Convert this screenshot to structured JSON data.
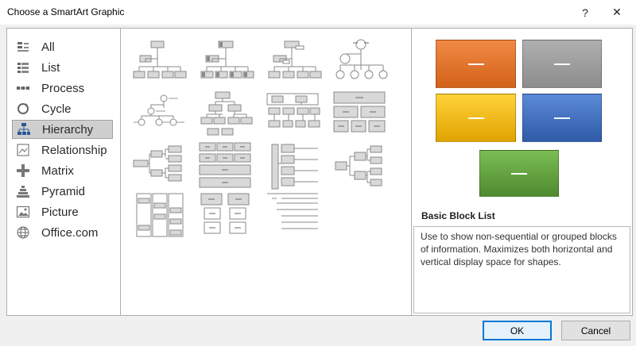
{
  "window": {
    "title": "Choose a SmartArt Graphic",
    "help_label": "?",
    "close_label": "✕"
  },
  "categories": [
    {
      "label": "All",
      "icon": "all-icon"
    },
    {
      "label": "List",
      "icon": "list-icon"
    },
    {
      "label": "Process",
      "icon": "process-icon"
    },
    {
      "label": "Cycle",
      "icon": "cycle-icon"
    },
    {
      "label": "Hierarchy",
      "icon": "hierarchy-icon",
      "selected": true
    },
    {
      "label": "Relationship",
      "icon": "relationship-icon"
    },
    {
      "label": "Matrix",
      "icon": "matrix-icon"
    },
    {
      "label": "Pyramid",
      "icon": "pyramid-icon"
    },
    {
      "label": "Picture",
      "icon": "picture-icon"
    },
    {
      "label": "Office.com",
      "icon": "globe-icon"
    }
  ],
  "layouts": [
    {
      "id": "org-chart"
    },
    {
      "id": "picture-org-chart"
    },
    {
      "id": "name-title-org-chart"
    },
    {
      "id": "circle-picture-hierarchy"
    },
    {
      "id": "labeled-hierarchy"
    },
    {
      "id": "hierarchy"
    },
    {
      "id": "table-hierarchy"
    },
    {
      "id": "architecture-layout"
    },
    {
      "id": "horizontal-hierarchy"
    },
    {
      "id": "hierarchy-list"
    },
    {
      "id": "lined-list"
    },
    {
      "id": "horizontal-multi-level-hierarchy"
    },
    {
      "id": "descending-hierarchy"
    },
    {
      "id": "half-circle-org-chart"
    },
    {
      "id": "text-hierarchy"
    }
  ],
  "preview": {
    "colors": [
      "#e16a24",
      "#9a9a9a",
      "#f0b400",
      "#3b6cbc",
      "#5e9e3c"
    ],
    "layout_title": "Basic Block List",
    "description": "Use to show non-sequential or grouped blocks of information. Maximizes both horizontal and vertical display space for shapes."
  },
  "buttons": {
    "ok_label": "OK",
    "cancel_label": "Cancel"
  }
}
